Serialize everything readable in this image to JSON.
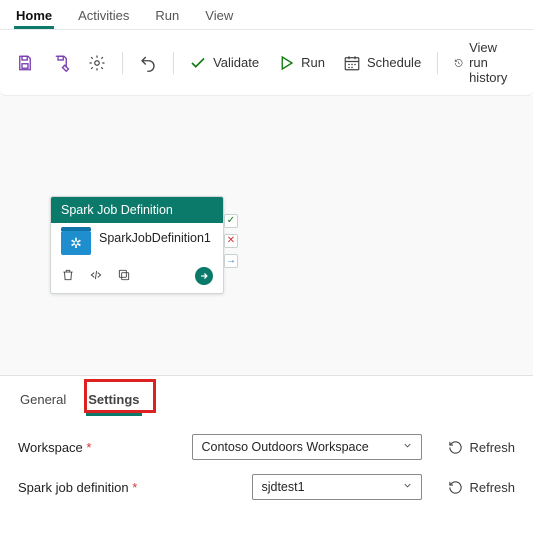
{
  "menu": {
    "tabs": [
      "Home",
      "Activities",
      "Run",
      "View"
    ],
    "active": "Home"
  },
  "toolbar": {
    "validate": "Validate",
    "run": "Run",
    "schedule": "Schedule",
    "history": "View run history"
  },
  "node": {
    "header": "Spark Job Definition",
    "title": "SparkJobDefinition1"
  },
  "bottom_tabs": {
    "general": "General",
    "settings": "Settings",
    "active": "Settings"
  },
  "form": {
    "workspace_label": "Workspace",
    "workspace_value": "Contoso Outdoors Workspace",
    "spark_label": "Spark job definition",
    "spark_value": "sjdtest1",
    "refresh": "Refresh"
  }
}
